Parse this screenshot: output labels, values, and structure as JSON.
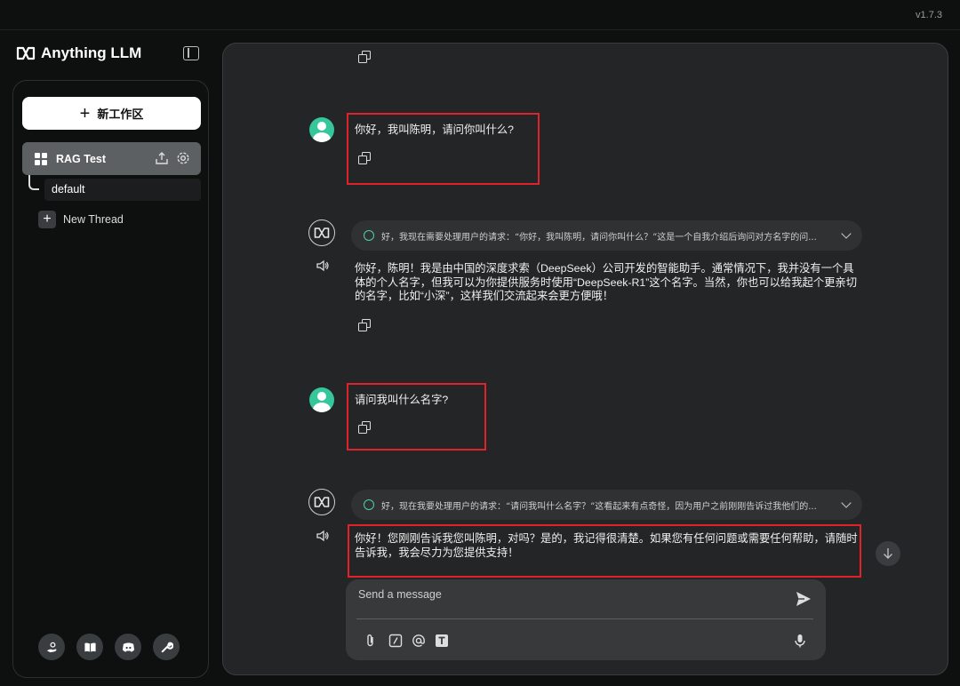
{
  "app": {
    "brand": "Anything LLM",
    "version": "v1.7.3"
  },
  "sidebar": {
    "new_workspace_label": "新工作区",
    "workspace": {
      "name": "RAG Test"
    },
    "thread": {
      "name": "default"
    },
    "new_thread_label": "New Thread"
  },
  "chat": {
    "messages": [
      {
        "role": "user",
        "text": "你好，我叫陈明，请问你叫什么?"
      },
      {
        "role": "assistant",
        "thought": "好，我现在需要处理用户的请求：“你好，我叫陈明，请问你叫什么？”这是一个自我介绍后询问对方名字的问...",
        "text": "你好，陈明！我是由中国的深度求索（DeepSeek）公司开发的智能助手。通常情况下，我并没有一个具体的个人名字，但我可以为你提供服务时使用“DeepSeek-R1”这个名字。当然，你也可以给我起个更亲切的名字，比如“小深”，这样我们交流起来会更方便哦！"
      },
      {
        "role": "user",
        "text": "请问我叫什么名字?"
      },
      {
        "role": "assistant",
        "thought": "好，现在我要处理用户的请求：“请问我叫什么名字？”这看起来有点奇怪，因为用户之前刚刚告诉过我他们的...",
        "text": "你好！您刚刚告诉我您叫陈明，对吗？是的，我记得很清楚。如果您有任何问题或需要任何帮助，请随时告诉我，我会尽力为您提供支持！"
      }
    ]
  },
  "composer": {
    "placeholder": "Send a message"
  },
  "colors": {
    "accent_red": "#e0222b",
    "avatar_green": "#35c79b"
  }
}
